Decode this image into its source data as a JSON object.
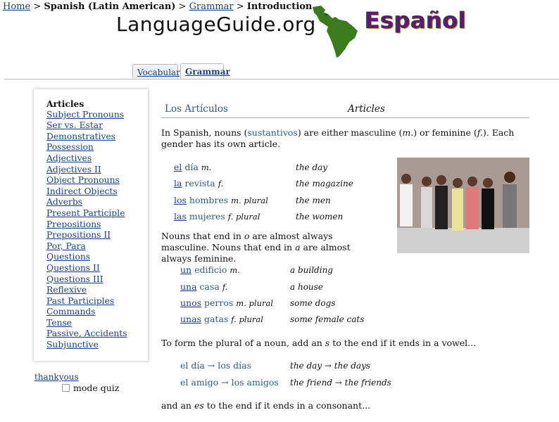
{
  "breadcrumb": {
    "home": "Home",
    "sep": ">",
    "language": "Spanish (Latin American)",
    "grammar": "Grammar",
    "current": "Introduction"
  },
  "header": {
    "logo": "LanguageGuide.org",
    "language_title": "Español"
  },
  "tabs": [
    {
      "label": "Vocabulary",
      "active": false
    },
    {
      "label": "Grammar",
      "active": true
    }
  ],
  "sidebar": {
    "items": [
      {
        "label": "Articles",
        "current": true
      },
      {
        "label": "Subject Pronouns"
      },
      {
        "label": "Ser vs. Estar"
      },
      {
        "label": "Demonstratives"
      },
      {
        "label": "Possession"
      },
      {
        "label": "Adjectives"
      },
      {
        "label": "Adjectives II"
      },
      {
        "label": "Object Pronouns"
      },
      {
        "label": "Indirect Objects"
      },
      {
        "label": "Adverbs"
      },
      {
        "label": "Present Participle"
      },
      {
        "label": "Prepositions"
      },
      {
        "label": "Prepositions II"
      },
      {
        "label": "Por, Para"
      },
      {
        "label": "Questions"
      },
      {
        "label": "Questions II"
      },
      {
        "label": "Questions III"
      },
      {
        "label": "Reflexive"
      },
      {
        "label": "Past Participles"
      },
      {
        "label": "Commands"
      },
      {
        "label": "Tense"
      },
      {
        "label": "Passive, Accidents"
      },
      {
        "label": "Subjunctive"
      }
    ]
  },
  "thankyous": "thankyous",
  "quiz_label": "mode quiz",
  "section": {
    "title_es": "Los Artículos",
    "title_en": "Articles"
  },
  "intro": {
    "a": "In Spanish, nouns (",
    "link": "sustantivos",
    "b": ") are either masculine (",
    "m": "m.",
    "c": ") or feminine (",
    "f": "f.",
    "d": "). Each gender has its own article."
  },
  "examples1": [
    {
      "art": "el",
      "noun": " día",
      "gender": "m.",
      "trans": "the day"
    },
    {
      "art": "la",
      "noun": " revista",
      "gender": "f.",
      "trans": "the magazine"
    },
    {
      "art": "los",
      "noun": " hombres",
      "gender": "m. plural",
      "trans": "the men"
    },
    {
      "art": "las",
      "noun": " mujeres",
      "gender": "f. plural",
      "trans": "the women"
    }
  ],
  "para2": {
    "a": "Nouns that end in ",
    "o": "o",
    "b": " are almost always masculine. Nouns that end in ",
    "aa": "a",
    "c": " are almost always feminine."
  },
  "examples2": [
    {
      "art": "un",
      "noun": " edificio",
      "gender": "m.",
      "trans": "a building"
    },
    {
      "art": "una",
      "noun": " casa",
      "gender": "f.",
      "trans": "a house"
    },
    {
      "art": "unos",
      "noun": " perros",
      "gender": "m. plural",
      "trans": "some dogs"
    },
    {
      "art": "unas",
      "noun": " gatas",
      "gender": "f. plural",
      "trans": "some female cats"
    }
  ],
  "para3": {
    "a": "To form the plural of a noun, add an ",
    "s": "s",
    "b": " to the end if it ends in a vowel..."
  },
  "plurals": [
    {
      "es": "el día → los días",
      "en": "the day → the days"
    },
    {
      "es": "el amigo → los amigos",
      "en": "the friend → the friends"
    }
  ],
  "para4": {
    "a": "and an ",
    "es": "es",
    "b": " to the end if it ends in a consonant..."
  },
  "colors": {
    "link": "#1a3d8f",
    "accent": "#2a5e8a"
  }
}
